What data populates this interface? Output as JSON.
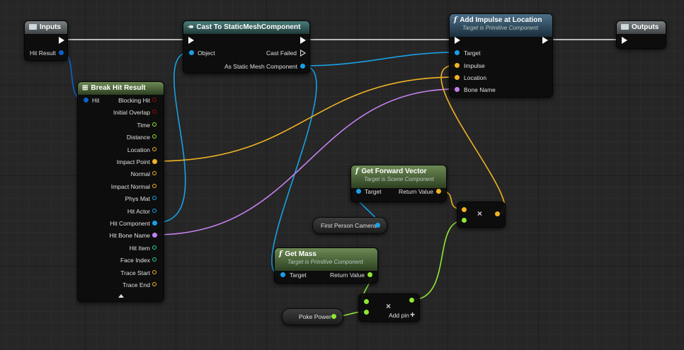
{
  "colors": {
    "exec": "#ffffff",
    "struct": "#0b62c9",
    "object": "#1aa0e5",
    "vector": "#f0b325",
    "float": "#8fe834",
    "name": "#c480ee",
    "bool": "#910b0b",
    "transform": "#e4822b",
    "rotator": "#8ab6f3",
    "int": "#21d6a1"
  },
  "nodes": {
    "inputs": {
      "title": "Inputs",
      "icon": "table-icon",
      "hit_result": "Hit Result"
    },
    "cast": {
      "title": "Cast To StaticMeshComponent",
      "object": "Object",
      "cast_failed": "Cast Failed",
      "as_smc": "As Static Mesh Component"
    },
    "impulse": {
      "title": "Add Impulse at Location",
      "subtitle": "Target is Primitive Component",
      "target": "Target",
      "impulse": "Impulse",
      "location": "Location",
      "bone_name": "Bone Name"
    },
    "outputs": {
      "title": "Outputs",
      "icon": "table-icon"
    },
    "break_hit": {
      "title": "Break Hit Result",
      "hit": "Hit",
      "outputs": [
        "Blocking Hit",
        "Initial Overlap",
        "Time",
        "Distance",
        "Location",
        "Impact Point",
        "Normal",
        "Impact Normal",
        "Phys Mat",
        "Hit Actor",
        "Hit Component",
        "Hit Bone Name",
        "Hit Item",
        "Face Index",
        "Trace Start",
        "Trace End"
      ],
      "output_types": [
        "bool",
        "bool",
        "float",
        "float",
        "vector",
        "vector",
        "vector",
        "vector",
        "object",
        "object",
        "object",
        "name",
        "int",
        "int",
        "vector",
        "vector"
      ],
      "output_connected": [
        false,
        false,
        false,
        false,
        false,
        true,
        false,
        false,
        false,
        false,
        true,
        true,
        false,
        false,
        false,
        false
      ]
    },
    "forward": {
      "title": "Get Forward Vector",
      "subtitle": "Target is Scene Component",
      "target": "Target",
      "return_value": "Return Value"
    },
    "camera": {
      "label": "First Person Camera"
    },
    "mass": {
      "title": "Get Mass",
      "subtitle": "Target is Primitive Component",
      "target": "Target",
      "return_value": "Return Value"
    },
    "poke": {
      "label": "Poke Power"
    },
    "multiply_vec": {
      "symbol": "×"
    },
    "multiply_float": {
      "symbol": "×",
      "add_pin": "Add pin",
      "add_symbol": "+"
    }
  }
}
